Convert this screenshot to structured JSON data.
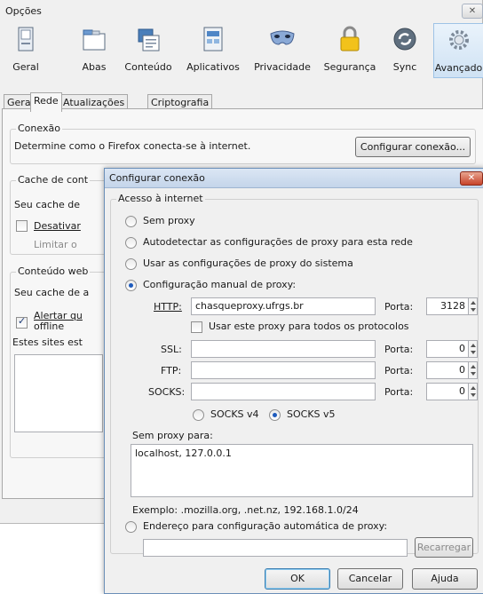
{
  "window": {
    "title": "Opções",
    "close_glyph": "✕"
  },
  "toolbar": [
    {
      "label": "Geral",
      "icon": "general-icon"
    },
    {
      "label": "Abas",
      "icon": "tabs-icon"
    },
    {
      "label": "Conteúdo",
      "icon": "content-icon"
    },
    {
      "label": "Aplicativos",
      "icon": "applications-icon"
    },
    {
      "label": "Privacidade",
      "icon": "privacy-mask-icon"
    },
    {
      "label": "Segurança",
      "icon": "security-lock-icon"
    },
    {
      "label": "Sync",
      "icon": "sync-icon"
    },
    {
      "label": "Avançado",
      "icon": "advanced-gear-icon",
      "selected": true
    }
  ],
  "tabs": [
    "Geral",
    "Rede",
    "Atualizações",
    "Criptografia"
  ],
  "active_tab": "Rede",
  "pane": {
    "connection_legend": "Conexão",
    "connection_text": "Determine como o Firefox conecta-se à internet.",
    "configure_button": "Configurar conexão...",
    "cache_legend": "Cache de cont",
    "cache_text": "Seu cache de",
    "cache_disable": "Desativar",
    "cache_limit": "Limitar o",
    "web_content_legend": "Conteúdo web",
    "web_content_text": "Seu cache de a",
    "alert_label_1": "Alertar qu",
    "alert_label_2": "offline",
    "sites_text": "Estes sites est"
  },
  "dialog": {
    "title": "Configurar conexão",
    "close_glyph": "✕",
    "group_legend": "Acesso à internet",
    "options": {
      "no_proxy": "Sem proxy",
      "auto_detect": "Autodetectar as configurações de proxy para esta rede",
      "system": "Usar as configurações de proxy do sistema",
      "manual": "Configuração manual de proxy:"
    },
    "http": {
      "label": "HTTP:",
      "value": "chasqueproxy.ufrgs.br",
      "port_label": "Porta:",
      "port": "3128"
    },
    "same_proxy_label": "Usar este proxy para todos os protocolos",
    "ssl": {
      "label": "SSL:",
      "value": "",
      "port_label": "Porta:",
      "port": "0"
    },
    "ftp": {
      "label": "FTP:",
      "value": "",
      "port_label": "Porta:",
      "port": "0"
    },
    "socks": {
      "label": "SOCKS:",
      "value": "",
      "port_label": "Porta:",
      "port": "0"
    },
    "socks_v4": "SOCKS v4",
    "socks_v5": "SOCKS v5",
    "no_proxy_for_label": "Sem proxy para:",
    "no_proxy_for_value": "localhost, 127.0.0.1",
    "example": "Exemplo: .mozilla.org, .net.nz, 192.168.1.0/24",
    "auto_config_label": "Endereço para configuração automática de proxy:",
    "auto_config_value": "",
    "reload_button": "Recarregar",
    "ok_button": "OK",
    "cancel_button": "Cancelar",
    "help_button": "Ajuda"
  }
}
